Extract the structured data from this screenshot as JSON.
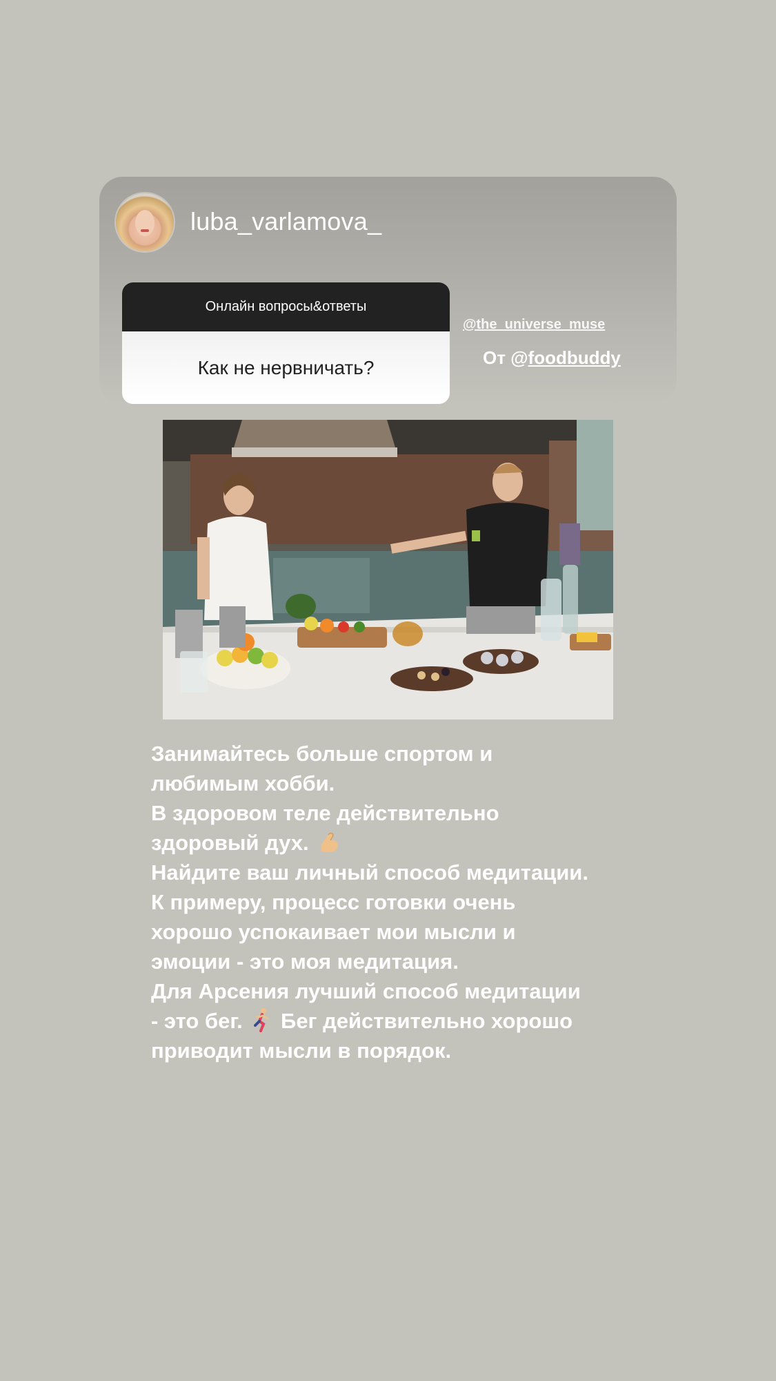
{
  "header": {
    "username": "luba_varlamova_",
    "avatar_icon": "profile-photo"
  },
  "question_sticker": {
    "title": "Онлайн вопросы&ответы",
    "question": "Как не нервничать?"
  },
  "mention": "@the_universe_muse",
  "attribution": {
    "prefix": "От @",
    "handle": "foodbuddy"
  },
  "photo": {
    "description_icon": "kitchen-photo"
  },
  "story_text": {
    "lines": [
      "Занимайтесь больше спортом и",
      "любимым хобби.",
      "В здоровом теле действительно",
      "здоровый дух.",
      "Найдите ваш личный способ медитации.",
      "К примеру, процесс готовки очень",
      "хорошо успокаивает мои мысли и",
      "эмоции - это моя медитация.",
      "Для Арсения лучший способ медитации",
      "- это бег.",
      "Бег действительно хорошо",
      "приводит мысли в порядок."
    ]
  },
  "colors": {
    "background": "#c3c2bb",
    "sticker_header": "#222222",
    "text": "#ffffff"
  }
}
